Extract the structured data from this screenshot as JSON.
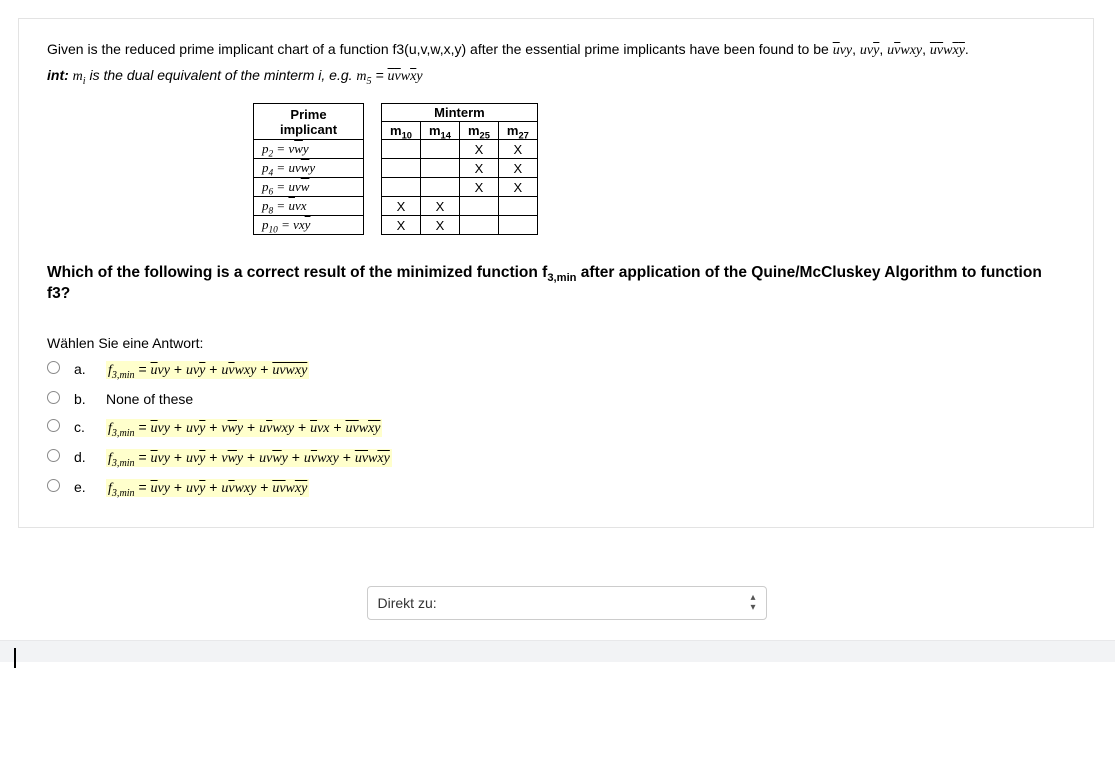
{
  "question": {
    "intro_line": "Given is the reduced prime implicant chart of a function f3(u,v,w,x,y) after the essential prime implicants have been found to be ",
    "essential_pis": "ūvy, uvȳ, uv̄wxy, ūv̄wx̄ȳ.",
    "hint_before": "int:",
    "hint_body": " mᵢ is the dual equivalent of the minterm i, e.g. m₅ = ",
    "hint_expr": "ūv̄wx̄y"
  },
  "table": {
    "head_prime": "Prime implicant",
    "head_minterm": "Minterm",
    "cols": [
      "m₁₀",
      "m₁₄",
      "m₂₅",
      "m₂₇"
    ],
    "col_ids": {
      "c0": "m₁₀",
      "c1": "m₁₄",
      "c2": "m₂₅",
      "c3": "m₂₇"
    },
    "rows": [
      {
        "name_id": "p2",
        "name_html": "p₂ = vw̄y",
        "cells": [
          "",
          "",
          "X",
          "X"
        ]
      },
      {
        "name_id": "p4",
        "name_html": "p₄ = uvw̄y",
        "cells": [
          "",
          "",
          "X",
          "X"
        ]
      },
      {
        "name_id": "p6",
        "name_html": "p₆ = uvw̄",
        "cells": [
          "",
          "",
          "X",
          "X"
        ]
      },
      {
        "name_id": "p8",
        "name_html": "p₈ = ūvx",
        "cells": [
          "X",
          "X",
          "",
          ""
        ]
      },
      {
        "name_id": "p10",
        "name_html": "p₁₀ = vxȳ",
        "cells": [
          "X",
          "X",
          "",
          ""
        ]
      }
    ]
  },
  "question2": "Which of the following is a correct result of the minimized function f₃,min after application of the Quine/McCluskey Algorithm to function f3?",
  "answers_lead": "Wählen Sie eine Antwort:",
  "options": {
    "a": {
      "key": "a.",
      "text": "f₃,min = ūvy + uvȳ + uv̄wxy + u̅v̅w̅x̅y̅"
    },
    "b": {
      "key": "b.",
      "text": "None of these"
    },
    "c": {
      "key": "c.",
      "text": "f₃,min = ūvy + uvȳ + vw̄y + uv̄wxy + ūvx + u̅v̅w̅x̅y̅"
    },
    "d": {
      "key": "d.",
      "text": "f₃,min = ūvy + uvȳ + vw̄y + uvw̄y + uv̄wxy + u̅v̅w̅x̅y̅"
    },
    "e": {
      "key": "e.",
      "text": "f₃,min = ūvy + uvȳ + uv̄wxy + u̅v̅w̅x̅y̅"
    }
  },
  "nav": {
    "label": "Direkt zu:"
  }
}
